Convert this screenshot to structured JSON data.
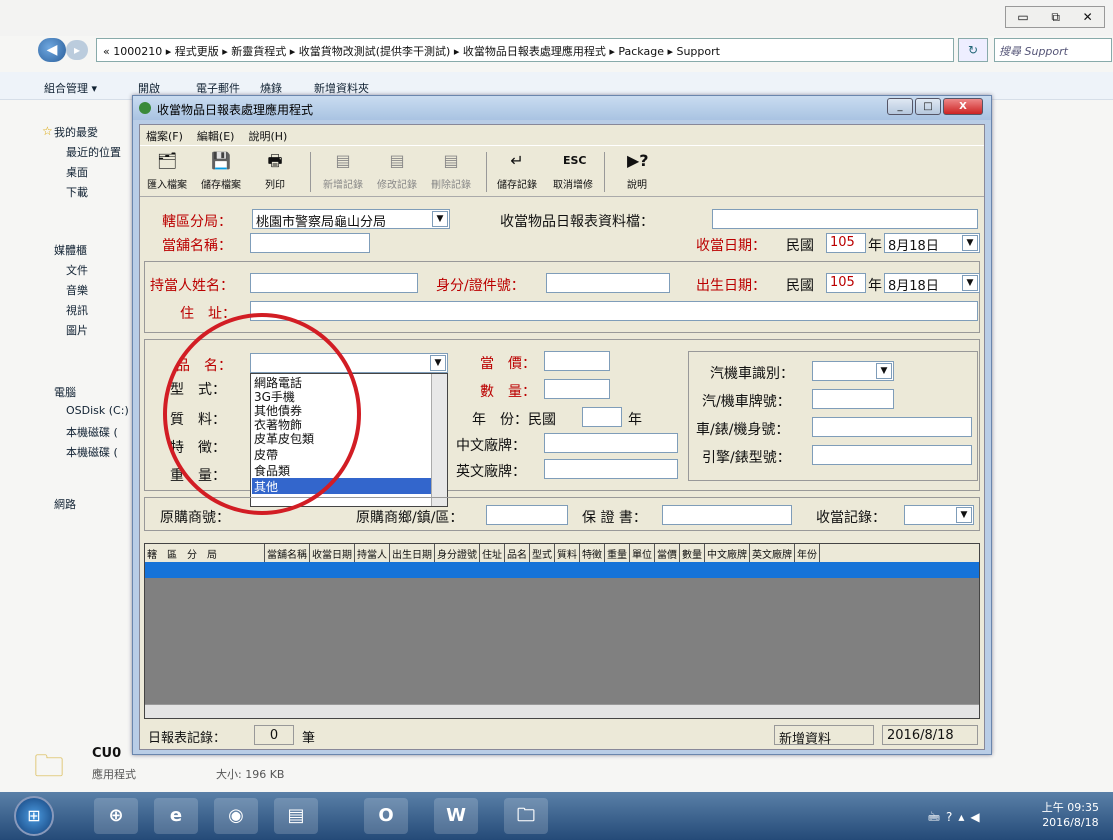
{
  "explorer": {
    "window_controls": [
      "▭",
      "⧉",
      "✕"
    ],
    "address": "« 1000210 ▸ 程式更版 ▸ 新靈貨程式 ▸ 收當貨物改測試(提供李干測試) ▸ 收當物品日報表處理應用程式 ▸ Package ▸ Support",
    "search_placeholder": "搜尋 Support",
    "toolbar": [
      "組合管理 ▾",
      "開啟",
      "電子郵件",
      "燒錄",
      "新增資料夾"
    ],
    "sidebar": [
      "我的最愛",
      "最近的位置",
      "桌面",
      "下載",
      "媒體櫃",
      "文件",
      "音樂",
      "視訊",
      "圖片",
      "電腦",
      "OSDisk (C:)",
      "本機磁碟 (",
      "本機磁碟 (",
      "網路"
    ],
    "file_name": "CU0",
    "file_type": "應用程式",
    "file_size": "大小: 196 KB"
  },
  "app": {
    "title": "收當物品日報表處理應用程式",
    "menu": [
      "檔案(F)",
      "編輯(E)",
      "說明(H)"
    ],
    "tools": [
      {
        "icon": "import-icon",
        "glyph": "🗂",
        "label": "匯入檔案"
      },
      {
        "icon": "save-icon",
        "glyph": "💾",
        "label": "儲存檔案"
      },
      {
        "icon": "print-icon",
        "glyph": "🖶",
        "label": "列印"
      },
      {
        "icon": "new-record-icon",
        "glyph": "▤",
        "label": "新增記錄"
      },
      {
        "icon": "edit-record-icon",
        "glyph": "▤",
        "label": "修改記錄"
      },
      {
        "icon": "delete-record-icon",
        "glyph": "▤",
        "label": "刪除記錄"
      },
      {
        "icon": "enter-icon",
        "glyph": "↵",
        "label": "儲存記錄"
      },
      {
        "icon": "esc-icon",
        "glyph": "ESC",
        "label": "取消增修"
      },
      {
        "icon": "help-icon",
        "glyph": "▶?",
        "label": "說明"
      }
    ],
    "form": {
      "district_label": "轄區分局：",
      "district_value": "桃園市警察局龜山分局",
      "file_label": "收當物品日報表資料檔：",
      "file_value": "",
      "shop_label": "當舖名稱：",
      "shop_value": "",
      "pawn_date_label": "收當日期：",
      "roc_label": "民國",
      "pawn_year": "105",
      "year_label": "年",
      "pawn_date": "8月18日",
      "holder_label": "持當人姓名：",
      "holder_value": "",
      "id_label": "身分/證件號：",
      "id_value": "",
      "birth_label": "出生日期：",
      "birth_year": "105",
      "birth_date": "8月18日",
      "addr_label": "住　址：",
      "addr_value": "",
      "item_label": "品　名：",
      "item_value": "",
      "model_label": "型　式：",
      "material_label": "質　料：",
      "feature_label": "特　徵：",
      "weight_label": "重　量：",
      "price_label": "當　價：",
      "price_value": "",
      "qty_label": "數　量：",
      "qty_value": "",
      "year_made_label": "年　份：民國",
      "year_made_value": "",
      "year_unit": "年",
      "cn_brand_label": "中文廠牌：",
      "cn_brand_value": "",
      "en_brand_label": "英文廠牌：",
      "en_brand_value": "",
      "vehicle_type_label": "汽機車識別：",
      "vehicle_type_value": "",
      "plate_label": "汽/機車牌號：",
      "plate_value": "",
      "body_no_label": "車/錶/機身號：",
      "body_no_value": "",
      "engine_label": "引擎/錶型號：",
      "engine_value": "",
      "orig_shop_label": "原購商號：",
      "orig_area_label": "原購商鄉/鎮/區：",
      "orig_area_value": "",
      "warranty_label": "保 證 書：",
      "warranty_value": "",
      "record_label": "收當記錄：",
      "record_value": ""
    },
    "item_options": [
      "網路電話",
      "3G手機",
      "其他債券",
      "衣著物飾",
      "皮革皮包類",
      "皮帶",
      "食品類",
      "其他"
    ],
    "selected_option": "其他",
    "grid_columns": [
      "轄　區　分　局",
      "當舖名稱",
      "收當日期",
      "持當人",
      "出生日期",
      "身分證號",
      "住址",
      "品名",
      "型式",
      "質料",
      "特徵",
      "重量",
      "單位",
      "當價",
      "數量",
      "中文廠牌",
      "英文廠牌",
      "年份"
    ],
    "status": {
      "records_label": "日報表記錄：",
      "records_count": "0",
      "records_unit": "筆",
      "mode": "新增資料",
      "date": "2016/8/18"
    }
  },
  "taskbar": {
    "time": "上午 09:35",
    "date": "2016/8/18"
  }
}
